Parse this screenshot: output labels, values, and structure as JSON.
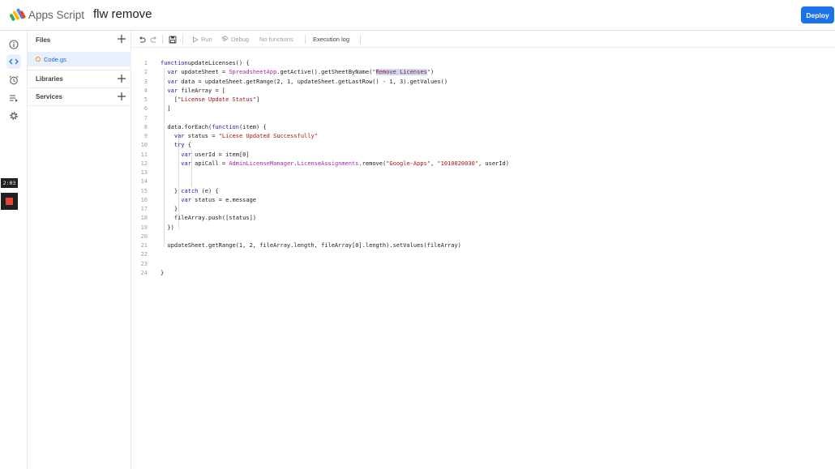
{
  "header": {
    "app_name": "Apps Script",
    "project_name": "flw remove",
    "deploy_label": "Deploy"
  },
  "rail": {
    "icons": [
      "info-icon",
      "code-icon",
      "alarm-icon",
      "executions-icon",
      "gear-icon"
    ],
    "timer": "2:03"
  },
  "panel": {
    "files_title": "Files",
    "file_name": "Code.gs",
    "libraries_title": "Libraries",
    "services_title": "Services"
  },
  "toolbar": {
    "run_label": "Run",
    "debug_label": "Debug",
    "function_select": "No functions",
    "execution_log_label": "Execution log"
  },
  "editor": {
    "lines": [
      {
        "n": "1",
        "tokens": [
          [
            "kw",
            "function"
          ],
          [
            "",
            "updateLicenses() {"
          ]
        ]
      },
      {
        "n": "2",
        "tokens": [
          [
            "",
            "  "
          ],
          [
            "kw",
            "var"
          ],
          [
            "",
            " updateSheet = "
          ],
          [
            "cls",
            "SpreadsheetApp"
          ],
          [
            "",
            ".getActive().getSheetByName("
          ],
          [
            "str",
            "\""
          ],
          [
            "str hl",
            "Remove Licenses"
          ],
          [
            "str",
            "\""
          ],
          [
            "",
            ")"
          ]
        ]
      },
      {
        "n": "3",
        "tokens": [
          [
            "",
            "  "
          ],
          [
            "kw",
            "var"
          ],
          [
            "",
            " data = updateSheet.getRange(2, 1, updateSheet.getLastRow() - 1, 3).getValues()"
          ]
        ]
      },
      {
        "n": "4",
        "tokens": [
          [
            "",
            "  "
          ],
          [
            "kw",
            "var"
          ],
          [
            "",
            " fileArray = ["
          ]
        ]
      },
      {
        "n": "5",
        "tokens": [
          [
            "",
            "    ["
          ],
          [
            "str",
            "\"License Update Status\""
          ],
          [
            "",
            "]"
          ]
        ]
      },
      {
        "n": "6",
        "tokens": [
          [
            "",
            "  ]"
          ]
        ]
      },
      {
        "n": "7",
        "tokens": []
      },
      {
        "n": "8",
        "tokens": [
          [
            "",
            "  data.forEach("
          ],
          [
            "kw",
            "function"
          ],
          [
            "",
            "(item) {"
          ]
        ]
      },
      {
        "n": "9",
        "tokens": [
          [
            "",
            "    "
          ],
          [
            "kw",
            "var"
          ],
          [
            "",
            " status = "
          ],
          [
            "str",
            "\"Licese Updated Successfully\""
          ]
        ]
      },
      {
        "n": "10",
        "tokens": [
          [
            "",
            "    "
          ],
          [
            "kw",
            "try"
          ],
          [
            "",
            " {"
          ]
        ]
      },
      {
        "n": "11",
        "tokens": [
          [
            "",
            "      "
          ],
          [
            "kw",
            "var"
          ],
          [
            "",
            " userId = item[0]"
          ]
        ]
      },
      {
        "n": "12",
        "tokens": [
          [
            "",
            "      "
          ],
          [
            "kw",
            "var"
          ],
          [
            "",
            " apiCall = "
          ],
          [
            "cls",
            "AdminLicenseManager"
          ],
          [
            "",
            "."
          ],
          [
            "cls",
            "LicenseAssignments"
          ],
          [
            "",
            ".remove("
          ],
          [
            "str",
            "\"Google-Apps\""
          ],
          [
            "",
            ", "
          ],
          [
            "str",
            "\"1010020030\""
          ],
          [
            "",
            ", userId)"
          ]
        ]
      },
      {
        "n": "13",
        "tokens": []
      },
      {
        "n": "14",
        "tokens": []
      },
      {
        "n": "15",
        "tokens": [
          [
            "",
            "    } "
          ],
          [
            "kw",
            "catch"
          ],
          [
            "",
            " (e) {"
          ]
        ]
      },
      {
        "n": "16",
        "tokens": [
          [
            "",
            "      "
          ],
          [
            "kw",
            "var"
          ],
          [
            "",
            " status = e.message"
          ]
        ]
      },
      {
        "n": "17",
        "tokens": [
          [
            "",
            "    }"
          ]
        ]
      },
      {
        "n": "18",
        "tokens": [
          [
            "",
            "    fileArray.push([status])"
          ]
        ]
      },
      {
        "n": "19",
        "tokens": [
          [
            "",
            "  })"
          ]
        ]
      },
      {
        "n": "20",
        "tokens": []
      },
      {
        "n": "21",
        "tokens": [
          [
            "",
            "  updateSheet.getRange(1, 2, fileArray.length, fileArray[0].length).setValues(fileArray)"
          ]
        ]
      },
      {
        "n": "22",
        "tokens": []
      },
      {
        "n": "23",
        "tokens": []
      },
      {
        "n": "24",
        "tokens": [
          [
            "",
            "}"
          ]
        ]
      }
    ]
  },
  "colors": {
    "accent": "#1a73e8",
    "keyword": "#1a1aa6",
    "string": "#a31515",
    "class": "#a626a4"
  }
}
